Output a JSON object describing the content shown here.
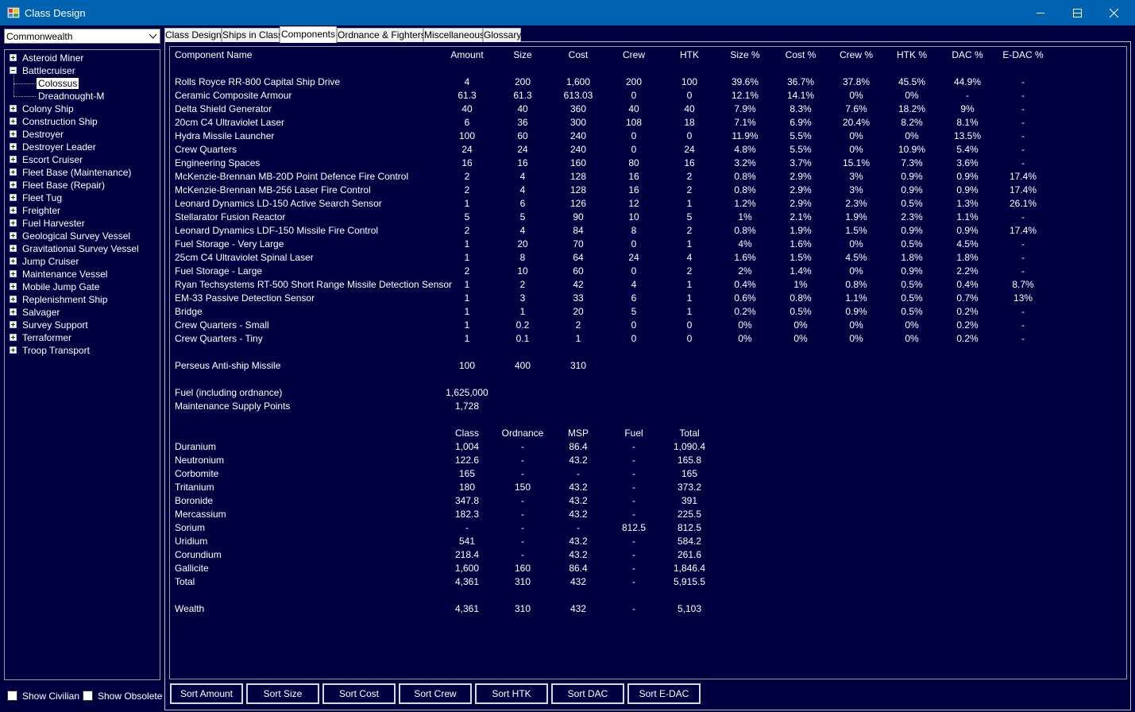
{
  "window": {
    "title": "Class Design"
  },
  "empire_select": {
    "value": "Commonwealth"
  },
  "tree": {
    "items": [
      {
        "label": "Asteroid Miner",
        "expanded": false
      },
      {
        "label": "Battlecruiser",
        "expanded": true,
        "children": [
          {
            "label": "Colossus",
            "selected": true
          },
          {
            "label": "Dreadnought-M",
            "selected": false
          }
        ]
      },
      {
        "label": "Colony Ship",
        "expanded": false
      },
      {
        "label": "Construction Ship",
        "expanded": false
      },
      {
        "label": "Destroyer",
        "expanded": false
      },
      {
        "label": "Destroyer Leader",
        "expanded": false
      },
      {
        "label": "Escort Cruiser",
        "expanded": false
      },
      {
        "label": "Fleet Base (Maintenance)",
        "expanded": false
      },
      {
        "label": "Fleet Base (Repair)",
        "expanded": false
      },
      {
        "label": "Fleet Tug",
        "expanded": false
      },
      {
        "label": "Freighter",
        "expanded": false
      },
      {
        "label": "Fuel Harvester",
        "expanded": false
      },
      {
        "label": "Geological Survey Vessel",
        "expanded": false
      },
      {
        "label": "Gravitational Survey Vessel",
        "expanded": false
      },
      {
        "label": "Jump Cruiser",
        "expanded": false
      },
      {
        "label": "Maintenance Vessel",
        "expanded": false
      },
      {
        "label": "Mobile Jump Gate",
        "expanded": false
      },
      {
        "label": "Replenishment Ship",
        "expanded": false
      },
      {
        "label": "Salvager",
        "expanded": false
      },
      {
        "label": "Survey Support",
        "expanded": false
      },
      {
        "label": "Terraformer",
        "expanded": false
      },
      {
        "label": "Troop Transport",
        "expanded": false
      }
    ]
  },
  "checkboxes": {
    "show_civilian": {
      "label": "Show Civilian",
      "checked": false
    },
    "show_obsolete": {
      "label": "Show Obsolete",
      "checked": false
    }
  },
  "tabs": [
    {
      "label": "Class Design",
      "active": false
    },
    {
      "label": "Ships in Class",
      "active": false
    },
    {
      "label": "Components",
      "active": true
    },
    {
      "label": "Ordnance & Fighters",
      "active": false
    },
    {
      "label": "Miscellaneous",
      "active": false
    },
    {
      "label": "Glossary",
      "active": false
    }
  ],
  "components": {
    "headers": [
      "Component Name",
      "Amount",
      "Size",
      "Cost",
      "Crew",
      "HTK",
      "Size %",
      "Cost %",
      "Crew %",
      "HTK %",
      "DAC %",
      "E-DAC %"
    ],
    "rows": [
      [
        "Rolls Royce RR-800 Capital Ship Drive",
        "4",
        "200",
        "1,600",
        "200",
        "100",
        "39.6%",
        "36.7%",
        "37.8%",
        "45.5%",
        "44.9%",
        "-"
      ],
      [
        "Ceramic Composite Armour",
        "61.3",
        "61.3",
        "613.03",
        "0",
        "0",
        "12.1%",
        "14.1%",
        "0%",
        "0%",
        "-",
        "-"
      ],
      [
        "Delta Shield Generator",
        "40",
        "40",
        "360",
        "40",
        "40",
        "7.9%",
        "8.3%",
        "7.6%",
        "18.2%",
        "9%",
        "-"
      ],
      [
        "20cm C4 Ultraviolet Laser",
        "6",
        "36",
        "300",
        "108",
        "18",
        "7.1%",
        "6.9%",
        "20.4%",
        "8.2%",
        "8.1%",
        "-"
      ],
      [
        "Hydra Missile Launcher",
        "100",
        "60",
        "240",
        "0",
        "0",
        "11.9%",
        "5.5%",
        "0%",
        "0%",
        "13.5%",
        "-"
      ],
      [
        "Crew Quarters",
        "24",
        "24",
        "240",
        "0",
        "24",
        "4.8%",
        "5.5%",
        "0%",
        "10.9%",
        "5.4%",
        "-"
      ],
      [
        "Engineering Spaces",
        "16",
        "16",
        "160",
        "80",
        "16",
        "3.2%",
        "3.7%",
        "15.1%",
        "7.3%",
        "3.6%",
        "-"
      ],
      [
        "McKenzie-Brennan MB-20D Point Defence Fire Control",
        "2",
        "4",
        "128",
        "16",
        "2",
        "0.8%",
        "2.9%",
        "3%",
        "0.9%",
        "0.9%",
        "17.4%"
      ],
      [
        "McKenzie-Brennan MB-256 Laser Fire Control",
        "2",
        "4",
        "128",
        "16",
        "2",
        "0.8%",
        "2.9%",
        "3%",
        "0.9%",
        "0.9%",
        "17.4%"
      ],
      [
        "Leonard Dynamics LD-150 Active Search Sensor",
        "1",
        "6",
        "126",
        "12",
        "1",
        "1.2%",
        "2.9%",
        "2.3%",
        "0.5%",
        "1.3%",
        "26.1%"
      ],
      [
        "Stellarator Fusion Reactor",
        "5",
        "5",
        "90",
        "10",
        "5",
        "1%",
        "2.1%",
        "1.9%",
        "2.3%",
        "1.1%",
        "-"
      ],
      [
        "Leonard Dynamics LDF-150 Missile Fire Control",
        "2",
        "4",
        "84",
        "8",
        "2",
        "0.8%",
        "1.9%",
        "1.5%",
        "0.9%",
        "0.9%",
        "17.4%"
      ],
      [
        "Fuel Storage - Very Large",
        "1",
        "20",
        "70",
        "0",
        "1",
        "4%",
        "1.6%",
        "0%",
        "0.5%",
        "4.5%",
        "-"
      ],
      [
        "25cm C4 Ultraviolet Spinal Laser",
        "1",
        "8",
        "64",
        "24",
        "4",
        "1.6%",
        "1.5%",
        "4.5%",
        "1.8%",
        "1.8%",
        "-"
      ],
      [
        "Fuel Storage - Large",
        "2",
        "10",
        "60",
        "0",
        "2",
        "2%",
        "1.4%",
        "0%",
        "0.9%",
        "2.2%",
        "-"
      ],
      [
        "Ryan Techsystems RT-500 Short Range Missile Detection Sensor",
        "1",
        "2",
        "42",
        "4",
        "1",
        "0.4%",
        "1%",
        "0.8%",
        "0.5%",
        "0.4%",
        "8.7%"
      ],
      [
        "EM-33 Passive Detection Sensor",
        "1",
        "3",
        "33",
        "6",
        "1",
        "0.6%",
        "0.8%",
        "1.1%",
        "0.5%",
        "0.7%",
        "13%"
      ],
      [
        "Bridge",
        "1",
        "1",
        "20",
        "5",
        "1",
        "0.2%",
        "0.5%",
        "0.9%",
        "0.5%",
        "0.2%",
        "-"
      ],
      [
        "Crew Quarters - Small",
        "1",
        "0.2",
        "2",
        "0",
        "0",
        "0%",
        "0%",
        "0%",
        "0%",
        "0.2%",
        "-"
      ],
      [
        "Crew Quarters - Tiny",
        "1",
        "0.1",
        "1",
        "0",
        "0",
        "0%",
        "0%",
        "0%",
        "0%",
        "0.2%",
        "-"
      ]
    ]
  },
  "ordnance": {
    "rows": [
      [
        "Perseus Anti-ship Missile",
        "100",
        "400",
        "310"
      ]
    ]
  },
  "supply": {
    "rows": [
      [
        "Fuel (including ordnance)",
        "1,625,000"
      ],
      [
        "Maintenance Supply Points",
        "1,728"
      ]
    ]
  },
  "minerals": {
    "headers": [
      "Class",
      "Ordnance",
      "MSP",
      "Fuel",
      "Total"
    ],
    "rows": [
      [
        "Duranium",
        "1,004",
        "-",
        "86.4",
        "-",
        "1,090.4"
      ],
      [
        "Neutronium",
        "122.6",
        "-",
        "43.2",
        "-",
        "165.8"
      ],
      [
        "Corbomite",
        "165",
        "-",
        "-",
        "-",
        "165"
      ],
      [
        "Tritanium",
        "180",
        "150",
        "43.2",
        "-",
        "373.2"
      ],
      [
        "Boronide",
        "347.8",
        "-",
        "43.2",
        "-",
        "391"
      ],
      [
        "Mercassium",
        "182.3",
        "-",
        "43.2",
        "-",
        "225.5"
      ],
      [
        "Sorium",
        "-",
        "-",
        "-",
        "812.5",
        "812.5"
      ],
      [
        "Uridium",
        "541",
        "-",
        "43.2",
        "-",
        "584.2"
      ],
      [
        "Corundium",
        "218.4",
        "-",
        "43.2",
        "-",
        "261.6"
      ],
      [
        "Gallicite",
        "1,600",
        "160",
        "86.4",
        "-",
        "1,846.4"
      ],
      [
        "Total",
        "4,361",
        "310",
        "432",
        "-",
        "5,915.5"
      ]
    ],
    "wealth": [
      "Wealth",
      "4,361",
      "310",
      "432",
      "-",
      "5,103"
    ]
  },
  "sort_buttons": [
    "Sort Amount",
    "Sort Size",
    "Sort Cost",
    "Sort Crew",
    "Sort HTK",
    "Sort DAC",
    "Sort E-DAC"
  ]
}
